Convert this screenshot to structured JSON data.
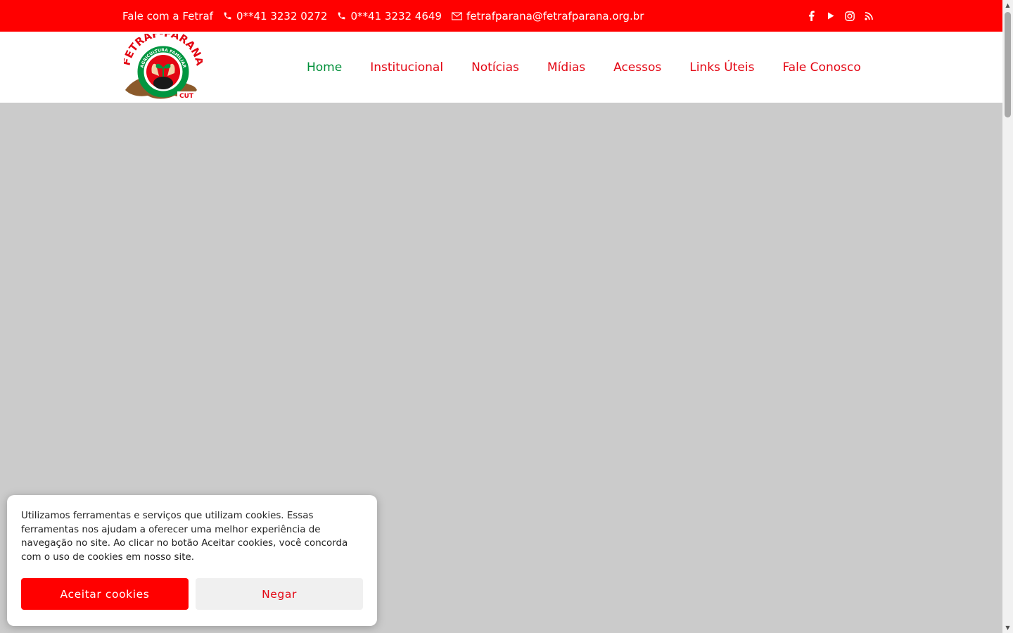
{
  "topbar": {
    "contact_label": "Fale com a Fetraf",
    "phone_1": "0**41 3232 0272",
    "phone_2": "0**41 3232 4649",
    "email": "fetrafparana@fetrafparana.org.br",
    "social_icons": [
      "facebook-icon",
      "youtube-icon",
      "instagram-icon",
      "rss-icon"
    ]
  },
  "logo": {
    "arc_text": "FETRAF-PARANÁ",
    "ring_text": "AGRICULTURA FAMILIAR",
    "badge_text": "CUT"
  },
  "nav": {
    "items": [
      {
        "label": "Home",
        "active": true
      },
      {
        "label": "Institucional"
      },
      {
        "label": "Notícias"
      },
      {
        "label": "Mídias"
      },
      {
        "label": "Acessos"
      },
      {
        "label": "Links Úteis"
      },
      {
        "label": "Fale Conosco"
      }
    ]
  },
  "cookie_banner": {
    "text": "Utilizamos ferramentas e serviços que utilizam cookies. Essas ferramentas nos ajudam a oferecer uma melhor experiência de navegação no site. Ao clicar no botão Aceitar cookies, você concorda com o uso de cookies em nosso site.",
    "accept_label": "Aceitar cookies",
    "deny_label": "Negar"
  },
  "colors": {
    "brand_red": "#ff0000",
    "nav_red": "#e30613",
    "nav_active_green": "#008f39",
    "hero_placeholder": "#cbcbcb"
  }
}
